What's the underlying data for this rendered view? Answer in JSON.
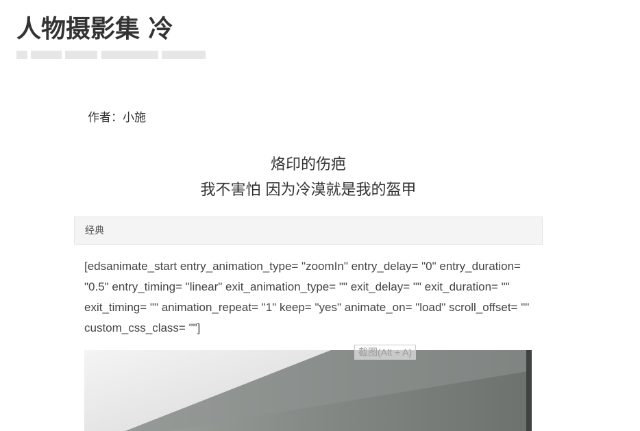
{
  "page": {
    "title": "人物摄影集 冷",
    "author": "作者：小施",
    "subtitle_lines": [
      "烙印的伤疤",
      "我不害怕 因为冷漠就是我的盔甲"
    ]
  },
  "tab": {
    "label": "经典"
  },
  "content": {
    "shortcode_text": "[edsanimate_start entry_animation_type= \"zoomIn\" entry_delay= \"0\" entry_duration= \"0.5\" entry_timing= \"linear\" exit_animation_type= \"\" exit_delay= \"\" exit_duration= \"\" exit_timing= \"\" animation_repeat= \"1\" keep= \"yes\" animate_on= \"load\" scroll_offset= \"\" custom_css_class= \"\"]"
  },
  "overlay": {
    "screenshot_tooltip": "截图(Alt + A)"
  },
  "colors": {
    "title_text": "#333333",
    "tab_background": "#f4f4f4",
    "meta_placeholder": "#e6e6e6"
  }
}
